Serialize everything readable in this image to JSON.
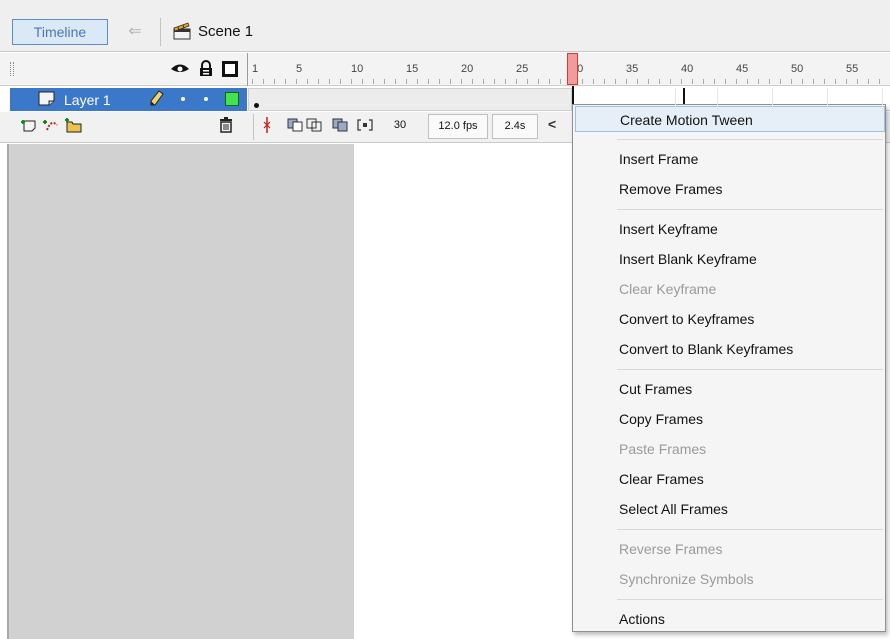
{
  "header": {
    "timeline_label": "Timeline",
    "back_glyph": "⇐",
    "scene_label": "Scene 1",
    "icons": [
      "back-arrow-icon",
      "scene-clapper-icon"
    ]
  },
  "timeline": {
    "ruler_ticks": [
      "1",
      "5",
      "10",
      "15",
      "20",
      "25",
      "30",
      "35",
      "40",
      "45",
      "50",
      "55"
    ],
    "current_frame": 30,
    "layer": {
      "name": "Layer 1",
      "outline_color": "#44e24c"
    },
    "header_icons": [
      "eye-icon",
      "lock-icon",
      "outline-icon"
    ],
    "layer_icons": [
      "layer-page-icon",
      "pencil-icon"
    ]
  },
  "controls": {
    "frame": "30",
    "fps": "12.0 fps",
    "time": "2.4s",
    "scroll_glyph": "<",
    "icons": [
      "add-layer-icon",
      "add-motion-guide-icon",
      "add-folder-icon",
      "trash-icon",
      "center-frame-icon",
      "onion-skin-icon",
      "onion-skin-outlines-icon",
      "edit-multiple-frames-icon",
      "modify-onion-markers-icon"
    ]
  },
  "context_menu": {
    "groups": [
      [
        {
          "label": "Create Motion Tween",
          "enabled": true,
          "highlighted": true
        }
      ],
      [
        {
          "label": "Insert Frame",
          "enabled": true
        },
        {
          "label": "Remove Frames",
          "enabled": true
        }
      ],
      [
        {
          "label": "Insert Keyframe",
          "enabled": true
        },
        {
          "label": "Insert Blank Keyframe",
          "enabled": true
        },
        {
          "label": "Clear Keyframe",
          "enabled": false
        },
        {
          "label": "Convert to Keyframes",
          "enabled": true
        },
        {
          "label": "Convert to Blank Keyframes",
          "enabled": true
        }
      ],
      [
        {
          "label": "Cut Frames",
          "enabled": true
        },
        {
          "label": "Copy Frames",
          "enabled": true
        },
        {
          "label": "Paste Frames",
          "enabled": false
        },
        {
          "label": "Clear Frames",
          "enabled": true
        },
        {
          "label": "Select All Frames",
          "enabled": true
        }
      ],
      [
        {
          "label": "Reverse Frames",
          "enabled": false
        },
        {
          "label": "Synchronize Symbols",
          "enabled": false
        }
      ],
      [
        {
          "label": "Actions",
          "enabled": true
        }
      ]
    ]
  },
  "colors": {
    "selection_blue": "#3c78c9",
    "playhead_red": "#f19b9b",
    "menu_highlight": "#e6eff8",
    "stage_gray": "#d1d1d1"
  }
}
